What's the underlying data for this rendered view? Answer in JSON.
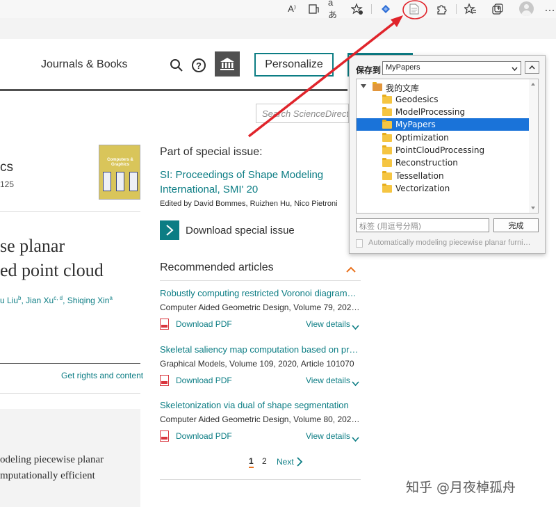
{
  "browser": {
    "toolbar_icons": [
      "read-aloud-icon",
      "immersive-reader-icon",
      "translate-icon",
      "add-favorite-icon",
      "extension-blue-icon",
      "zotero-save-icon",
      "extensions-icon",
      "favorites-icon",
      "collections-icon",
      "profile-icon",
      "more-icon"
    ],
    "translate_glyph": "aあ",
    "read_aloud_glyph": "A⁾"
  },
  "header": {
    "nav_link": "Journals & Books",
    "personalize_label": "Personalize",
    "search_placeholder": "Search ScienceDirect"
  },
  "article": {
    "journal_fragment": "cs",
    "volume_fragment": "125",
    "cover_title": "Computers & Graphics",
    "title_lines": [
      "se planar",
      "ed point cloud"
    ],
    "authors": [
      {
        "name": "u Liu",
        "sup": "b"
      },
      {
        "name": "Jian Xu",
        "sup": "c, d"
      },
      {
        "name": "Shiqing Xin",
        "sup": "a"
      }
    ],
    "rights_link": "Get rights and content",
    "abstract_lines": [
      "odeling piecewise planar",
      "mputationally efficient"
    ]
  },
  "special_issue": {
    "label": "Part of special issue:",
    "title": "SI: Proceedings of Shape Modeling International, SMI' 20",
    "editors": "Edited by David Bommes, Ruizhen Hu, Nico Pietroni",
    "download_label": "Download special issue"
  },
  "recommended": {
    "heading": "Recommended articles",
    "pdf_label": "Download PDF",
    "details_label": "View details",
    "items": [
      {
        "title": "Robustly computing restricted Voronoi diagram…",
        "source": "Computer Aided Geometric Design, Volume 79, 2020, …"
      },
      {
        "title": "Skeletal saliency map computation based on pr…",
        "source": "Graphical Models, Volume 109, 2020, Article 101070"
      },
      {
        "title": "Skeletonization via dual of shape segmentation",
        "source": "Computer Aided Geometric Design, Volume 80, 2020, …"
      }
    ],
    "pager": {
      "page1": "1",
      "page2": "2",
      "next": "Next"
    }
  },
  "save_popup": {
    "save_to_label": "保存到",
    "selected_collection": "MyPapers",
    "library_name": "我的文库",
    "folders": [
      "Geodesics",
      "ModelProcessing",
      "MyPapers",
      "Optimization",
      "PointCloudProcessing",
      "Reconstruction",
      "Tessellation",
      "Vectorization"
    ],
    "selected_folder": "MyPapers",
    "tags_placeholder": "标签 (用逗号分隔)",
    "done_label": "完成",
    "item_title": "Automatically modeling piecewise planar furni…"
  },
  "watermark": "知乎 @月夜棹孤舟",
  "colors": {
    "accent_teal": "#0c7d84",
    "selection_blue": "#1a73d9",
    "annotation_red": "#e0242b",
    "orange": "#e9711c"
  }
}
